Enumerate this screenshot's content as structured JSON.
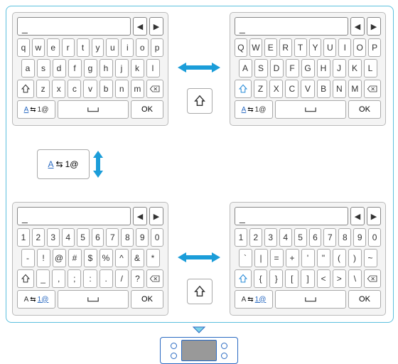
{
  "cursor": "_",
  "ok": "OK",
  "kb1": {
    "r1": [
      "q",
      "w",
      "e",
      "r",
      "t",
      "y",
      "u",
      "i",
      "o",
      "p"
    ],
    "r2": [
      "a",
      "s",
      "d",
      "f",
      "g",
      "h",
      "j",
      "k",
      "l"
    ],
    "r3": [
      "z",
      "x",
      "c",
      "v",
      "b",
      "n",
      "m"
    ]
  },
  "kb2": {
    "r1": [
      "Q",
      "W",
      "E",
      "R",
      "T",
      "Y",
      "U",
      "I",
      "O",
      "P"
    ],
    "r2": [
      "A",
      "S",
      "D",
      "F",
      "G",
      "H",
      "J",
      "K",
      "L"
    ],
    "r3": [
      "Z",
      "X",
      "C",
      "V",
      "B",
      "N",
      "M"
    ]
  },
  "kb3": {
    "r1": [
      "1",
      "2",
      "3",
      "4",
      "5",
      "6",
      "7",
      "8",
      "9",
      "0"
    ],
    "r2": [
      "-",
      "!",
      "@",
      "#",
      "$",
      "%",
      "^",
      "&",
      "*"
    ],
    "r3": [
      "_",
      ",",
      ";",
      ":",
      ".",
      "/",
      "?"
    ]
  },
  "kb4": {
    "r1": [
      "1",
      "2",
      "3",
      "4",
      "5",
      "6",
      "7",
      "8",
      "9",
      "0"
    ],
    "r2": [
      "`",
      "|",
      "=",
      "+",
      "'",
      "\"",
      "(",
      ")",
      "~"
    ],
    "r3": [
      "{",
      "}",
      "[",
      "]",
      "<",
      ">",
      "\\"
    ]
  },
  "mode": {
    "alpha": "A",
    "sym": "1@"
  }
}
